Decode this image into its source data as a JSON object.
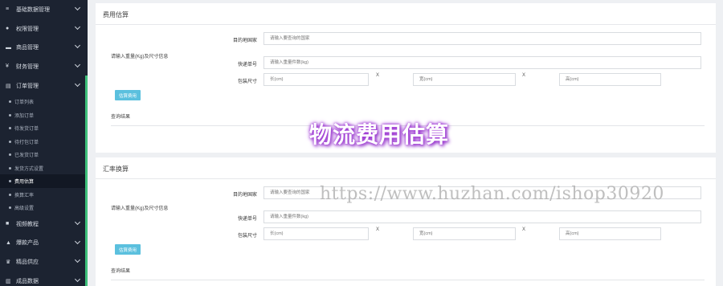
{
  "sidebar": {
    "top_items": [
      {
        "icon": "database-icon",
        "glyph": "≡",
        "label": "基础数据管理"
      },
      {
        "icon": "user-icon",
        "glyph": "●",
        "label": "权限管理"
      },
      {
        "icon": "cart-icon",
        "glyph": "▬",
        "label": "商品管理"
      },
      {
        "icon": "yen-icon",
        "glyph": "¥",
        "label": "财务管理"
      },
      {
        "icon": "file-icon",
        "glyph": "▤",
        "label": "订单管理"
      }
    ],
    "sub_items": [
      "订单列表",
      "添加订单",
      "待发货订单",
      "待打包订单",
      "已发货订单",
      "发货方式设置",
      "费用估算",
      "换算汇率",
      "高级设置"
    ],
    "active_sub": 6,
    "bottom_items": [
      {
        "icon": "video-icon",
        "glyph": "■",
        "label": "视频教程"
      },
      {
        "icon": "rocket-icon",
        "glyph": "▲",
        "label": "爆款产品"
      },
      {
        "icon": "trophy-icon",
        "glyph": "♛",
        "label": "精品供应"
      },
      {
        "icon": "chart-icon",
        "glyph": "▥",
        "label": "成品数据"
      }
    ]
  },
  "panels": [
    {
      "title": "费用估算",
      "left_label": "请输入重量(Kg)及尺寸信息",
      "destination_label": "目的地国家",
      "destination_placeholder": "请输入要查询的国家",
      "weight_label": "快递单号",
      "weight_placeholder": "请输入重量件数(kg)",
      "size_label": "包装尺寸",
      "length_placeholder": "长(cm)",
      "width_placeholder": "宽(cm)",
      "height_placeholder": "高(cm)",
      "x_sign": "X",
      "button": "估算费用",
      "result": "查询结果"
    },
    {
      "title": "汇率换算",
      "left_label": "请输入重量(Kg)及尺寸信息",
      "destination_label": "目的地国家",
      "destination_placeholder": "请输入要查询的国家",
      "weight_label": "快递单号",
      "weight_placeholder": "请输入重量件数(kg)",
      "size_label": "包装尺寸",
      "length_placeholder": "长(cm)",
      "width_placeholder": "宽(cm)",
      "height_placeholder": "高(cm)",
      "x_sign": "X",
      "button": "估算费用",
      "result": "查询结果"
    }
  ],
  "overlay_text": "物流费用估算",
  "watermark_text": "https://www.huzhan.com/ishop30920",
  "colors": {
    "sidebar": "#1c2331",
    "accent_bar": "#3ec07a",
    "button": "#5bc0de",
    "overlay_glow": "#a03bd6"
  }
}
